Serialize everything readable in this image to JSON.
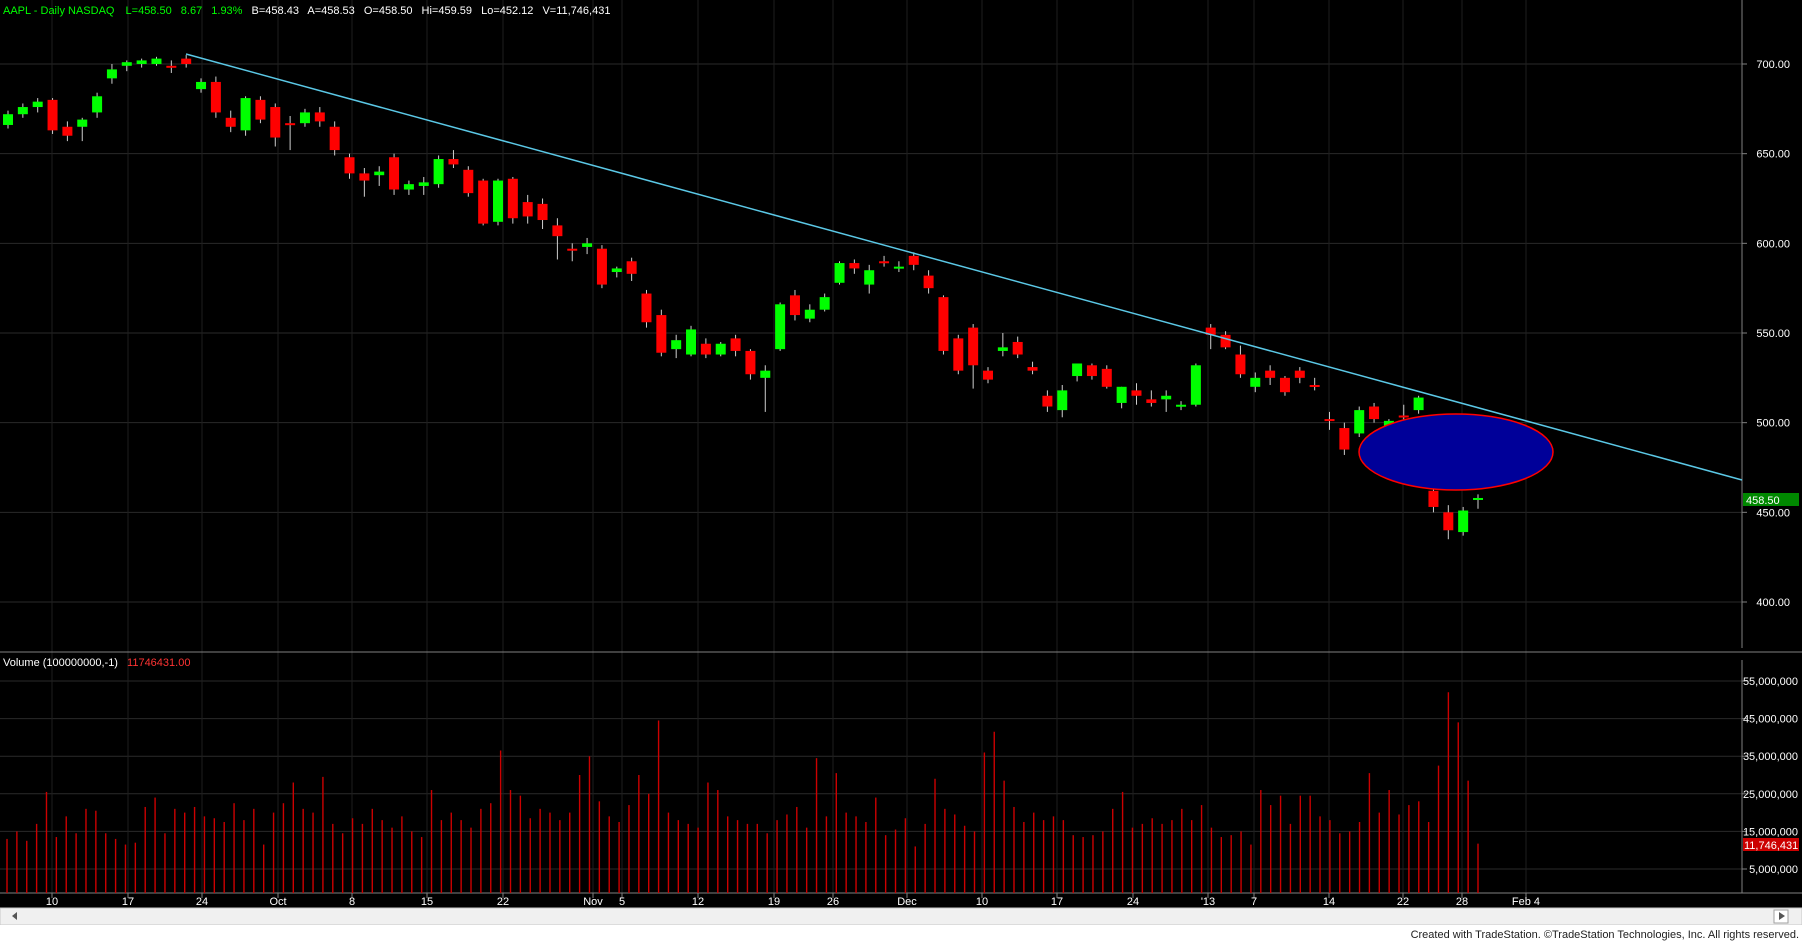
{
  "header": {
    "symbol_label": "AAPL - Daily  NASDAQ",
    "last": "L=458.50",
    "change": "8.67",
    "change_pct": "1.93%",
    "bid": "B=458.43",
    "ask": "A=458.53",
    "open": "O=458.50",
    "high": "Hi=459.59",
    "low": "Lo=452.12",
    "volume": "V=11,746,431"
  },
  "volume_header": {
    "label": "Volume (100000000,-1)",
    "value": "11746431.00"
  },
  "footer": {
    "credit": "Created with TradeStation. ©TradeStation Technologies, Inc. All rights reserved."
  },
  "colors": {
    "background": "#000000",
    "up": "#00ff00",
    "down": "#ff0000",
    "volume": "#cc0000",
    "trendline": "#5bc8e6",
    "ellipse_fill": "#000099",
    "ellipse_stroke": "#ff0000",
    "axis_text": "#ffffff",
    "header_text": "#00ff00",
    "last_price_tag": "#008800",
    "volume_tag": "#cc0000"
  },
  "chart_data": [
    {
      "type": "candlestick",
      "title": "AAPL - Daily  NASDAQ",
      "x_tick_labels": [
        "10",
        "17",
        "24",
        "Oct",
        "8",
        "15",
        "22",
        "Nov",
        "5",
        "12",
        "19",
        "26",
        "Dec",
        "10",
        "17",
        "24",
        "'13",
        "7",
        "14",
        "22",
        "28",
        "Feb 4"
      ],
      "y_tick_labels": [
        "700.00",
        "650.00",
        "600.00",
        "550.00",
        "500.00",
        "450.00",
        "400.00"
      ],
      "ylim": [
        372,
        734
      ],
      "last_price_label": "458.50",
      "grid": true,
      "candles": [
        {
          "o": 666,
          "h": 674,
          "l": 664,
          "c": 672
        },
        {
          "o": 672,
          "h": 678,
          "l": 670,
          "c": 676
        },
        {
          "o": 676,
          "h": 681,
          "l": 673,
          "c": 679
        },
        {
          "o": 680,
          "h": 681,
          "l": 661,
          "c": 663
        },
        {
          "o": 665,
          "h": 668,
          "l": 657,
          "c": 660
        },
        {
          "o": 665,
          "h": 670,
          "l": 657,
          "c": 669
        },
        {
          "o": 673,
          "h": 684,
          "l": 670,
          "c": 682
        },
        {
          "o": 692,
          "h": 700,
          "l": 689,
          "c": 697
        },
        {
          "o": 699,
          "h": 702,
          "l": 696,
          "c": 701
        },
        {
          "o": 700,
          "h": 703,
          "l": 698,
          "c": 702
        },
        {
          "o": 700,
          "h": 704,
          "l": 699,
          "c": 703
        },
        {
          "o": 699,
          "h": 702,
          "l": 695,
          "c": 698
        },
        {
          "o": 703,
          "h": 705,
          "l": 698,
          "c": 700
        },
        {
          "o": 686,
          "h": 692,
          "l": 684,
          "c": 690
        },
        {
          "o": 690,
          "h": 693,
          "l": 670,
          "c": 673
        },
        {
          "o": 670,
          "h": 674,
          "l": 662,
          "c": 665
        },
        {
          "o": 663,
          "h": 682,
          "l": 660,
          "c": 681
        },
        {
          "o": 680,
          "h": 682,
          "l": 667,
          "c": 669
        },
        {
          "o": 676,
          "h": 678,
          "l": 654,
          "c": 659
        },
        {
          "o": 667,
          "h": 671,
          "l": 652,
          "c": 666
        },
        {
          "o": 667,
          "h": 675,
          "l": 665,
          "c": 673
        },
        {
          "o": 673,
          "h": 676,
          "l": 665,
          "c": 668
        },
        {
          "o": 665,
          "h": 668,
          "l": 649,
          "c": 652
        },
        {
          "o": 648,
          "h": 650,
          "l": 636,
          "c": 639
        },
        {
          "o": 639,
          "h": 642,
          "l": 626,
          "c": 635
        },
        {
          "o": 638,
          "h": 643,
          "l": 632,
          "c": 640
        },
        {
          "o": 648,
          "h": 650,
          "l": 627,
          "c": 630
        },
        {
          "o": 630,
          "h": 635,
          "l": 627,
          "c": 633
        },
        {
          "o": 632,
          "h": 637,
          "l": 627,
          "c": 634
        },
        {
          "o": 633,
          "h": 649,
          "l": 631,
          "c": 647
        },
        {
          "o": 647,
          "h": 652,
          "l": 642,
          "c": 644
        },
        {
          "o": 641,
          "h": 643,
          "l": 626,
          "c": 628
        },
        {
          "o": 635,
          "h": 636,
          "l": 610,
          "c": 611
        },
        {
          "o": 612,
          "h": 636,
          "l": 610,
          "c": 635
        },
        {
          "o": 636,
          "h": 637,
          "l": 611,
          "c": 614
        },
        {
          "o": 623,
          "h": 627,
          "l": 611,
          "c": 615
        },
        {
          "o": 622,
          "h": 625,
          "l": 608,
          "c": 613
        },
        {
          "o": 610,
          "h": 614,
          "l": 591,
          "c": 604
        },
        {
          "o": 597,
          "h": 600,
          "l": 590,
          "c": 596
        },
        {
          "o": 598,
          "h": 603,
          "l": 594,
          "c": 600
        },
        {
          "o": 597,
          "h": 599,
          "l": 575,
          "c": 577
        },
        {
          "o": 584,
          "h": 587,
          "l": 581,
          "c": 586
        },
        {
          "o": 590,
          "h": 592,
          "l": 579,
          "c": 583
        },
        {
          "o": 572,
          "h": 574,
          "l": 553,
          "c": 556
        },
        {
          "o": 560,
          "h": 563,
          "l": 537,
          "c": 539
        },
        {
          "o": 541,
          "h": 549,
          "l": 536,
          "c": 546
        },
        {
          "o": 538,
          "h": 554,
          "l": 537,
          "c": 552
        },
        {
          "o": 544,
          "h": 547,
          "l": 536,
          "c": 538
        },
        {
          "o": 538,
          "h": 545,
          "l": 537,
          "c": 544
        },
        {
          "o": 547,
          "h": 549,
          "l": 537,
          "c": 540
        },
        {
          "o": 540,
          "h": 541,
          "l": 524,
          "c": 527
        },
        {
          "o": 525,
          "h": 532,
          "l": 506,
          "c": 529
        },
        {
          "o": 541,
          "h": 567,
          "l": 540,
          "c": 566
        },
        {
          "o": 571,
          "h": 574,
          "l": 557,
          "c": 560
        },
        {
          "o": 558,
          "h": 566,
          "l": 556,
          "c": 563
        },
        {
          "o": 563,
          "h": 572,
          "l": 562,
          "c": 570
        },
        {
          "o": 578,
          "h": 590,
          "l": 577,
          "c": 589
        },
        {
          "o": 589,
          "h": 591,
          "l": 583,
          "c": 586
        },
        {
          "o": 577,
          "h": 588,
          "l": 572,
          "c": 585
        },
        {
          "o": 590,
          "h": 593,
          "l": 587,
          "c": 589
        },
        {
          "o": 586,
          "h": 590,
          "l": 584,
          "c": 587
        },
        {
          "o": 593,
          "h": 595,
          "l": 585,
          "c": 588
        },
        {
          "o": 582,
          "h": 585,
          "l": 572,
          "c": 575
        },
        {
          "o": 570,
          "h": 571,
          "l": 538,
          "c": 540
        },
        {
          "o": 547,
          "h": 549,
          "l": 527,
          "c": 529
        },
        {
          "o": 553,
          "h": 555,
          "l": 519,
          "c": 532
        },
        {
          "o": 529,
          "h": 531,
          "l": 522,
          "c": 524
        },
        {
          "o": 540,
          "h": 550,
          "l": 537,
          "c": 542
        },
        {
          "o": 545,
          "h": 548,
          "l": 536,
          "c": 538
        },
        {
          "o": 531,
          "h": 534,
          "l": 527,
          "c": 529
        },
        {
          "o": 515,
          "h": 518,
          "l": 506,
          "c": 509
        },
        {
          "o": 507,
          "h": 521,
          "l": 503,
          "c": 518
        },
        {
          "o": 526,
          "h": 533,
          "l": 523,
          "c": 533
        },
        {
          "o": 532,
          "h": 533,
          "l": 524,
          "c": 526
        },
        {
          "o": 530,
          "h": 532,
          "l": 519,
          "c": 520
        },
        {
          "o": 511,
          "h": 520,
          "l": 508,
          "c": 520
        },
        {
          "o": 518,
          "h": 522,
          "l": 510,
          "c": 515
        },
        {
          "o": 513,
          "h": 518,
          "l": 509,
          "c": 511
        },
        {
          "o": 513,
          "h": 518,
          "l": 506,
          "c": 515
        },
        {
          "o": 509,
          "h": 512,
          "l": 507,
          "c": 510
        },
        {
          "o": 510,
          "h": 533,
          "l": 509,
          "c": 532
        },
        {
          "o": 553,
          "h": 555,
          "l": 541,
          "c": 549
        },
        {
          "o": 549,
          "h": 551,
          "l": 541,
          "c": 542
        },
        {
          "o": 538,
          "h": 543,
          "l": 525,
          "c": 527
        },
        {
          "o": 520,
          "h": 528,
          "l": 517,
          "c": 525
        },
        {
          "o": 529,
          "h": 532,
          "l": 521,
          "c": 525
        },
        {
          "o": 525,
          "h": 526,
          "l": 515,
          "c": 517
        },
        {
          "o": 529,
          "h": 531,
          "l": 522,
          "c": 525
        },
        {
          "o": 521,
          "h": 525,
          "l": 518,
          "c": 520
        },
        {
          "o": 502,
          "h": 506,
          "l": 496,
          "c": 501
        },
        {
          "o": 497,
          "h": 500,
          "l": 482,
          "c": 485
        },
        {
          "o": 494,
          "h": 509,
          "l": 492,
          "c": 507
        },
        {
          "o": 509,
          "h": 511,
          "l": 500,
          "c": 502
        },
        {
          "o": 498,
          "h": 502,
          "l": 496,
          "c": 501
        },
        {
          "o": 504,
          "h": 510,
          "l": 500,
          "c": 503
        },
        {
          "o": 507,
          "h": 515,
          "l": 505,
          "c": 514
        },
        {
          "o": 462,
          "h": 465,
          "l": 450,
          "c": 453
        },
        {
          "o": 450,
          "h": 454,
          "l": 435,
          "c": 440
        },
        {
          "o": 439,
          "h": 453,
          "l": 437,
          "c": 451
        },
        {
          "o": 458,
          "h": 460,
          "l": 452,
          "c": 458
        }
      ]
    },
    {
      "type": "bar",
      "title": "Volume (100000000,-1)",
      "y_tick_labels": [
        "55,000,000",
        "45,000,000",
        "35,000,000",
        "25,000,000",
        "15,000,000",
        "5,000,000"
      ],
      "ylim": [
        0,
        59000000
      ],
      "last_value_label": "11,746,431",
      "values": [
        13000000,
        15000000,
        12500000,
        17000000,
        25500000,
        13500000,
        19000000,
        14500000,
        21000000,
        20500000,
        14500000,
        13000000,
        11500000,
        12000000,
        21500000,
        24000000,
        14500000,
        21000000,
        20000000,
        21500000,
        19000000,
        18500000,
        17500000,
        22500000,
        18000000,
        21000000,
        11500000,
        20000000,
        22500000,
        28000000,
        21000000,
        20000000,
        29500000,
        17000000,
        14500000,
        18500000,
        17000000,
        21000000,
        18000000,
        16000000,
        19000000,
        15000000,
        13500000,
        26000000,
        18000000,
        20000000,
        18000000,
        16000000,
        21000000,
        22500000,
        36500000,
        26000000,
        24500000,
        18500000,
        21000000,
        20000000,
        18000000,
        20000000,
        30000000,
        35000000,
        23000000,
        19000000,
        17500000,
        22000000,
        30000000,
        25000000,
        44500000,
        20000000,
        18000000,
        17000000,
        16000000,
        28000000,
        26000000,
        19000000,
        18000000,
        17000000,
        17000000,
        14500000,
        18000000,
        19500000,
        21500000,
        16000000,
        34500000,
        19000000,
        30500000,
        20000000,
        19000000,
        17500000,
        24000000,
        14000000,
        15500000,
        18500000,
        11000000,
        17000000,
        29000000,
        21000000,
        19500000,
        16500000,
        15000000,
        36000000,
        41500000,
        28500000,
        21500000,
        17500000,
        20000000,
        18000000,
        19000000,
        18000000,
        14000000,
        13500000,
        14000000,
        15000000,
        21000000,
        25500000,
        16000000,
        17000000,
        18500000,
        17000000,
        18000000,
        21000000,
        18000000,
        22000000,
        16000000,
        13500000,
        14000000,
        15000000,
        11500000,
        26000000,
        22000000,
        24500000,
        17000000,
        24500000,
        24500000,
        19000000,
        18000000,
        14500000,
        15000000,
        17500000,
        30500000,
        20000000,
        26000000,
        19500000,
        22000000,
        23000000,
        17500000,
        32500000,
        52000000,
        44000000,
        28500000,
        11746431
      ]
    }
  ]
}
